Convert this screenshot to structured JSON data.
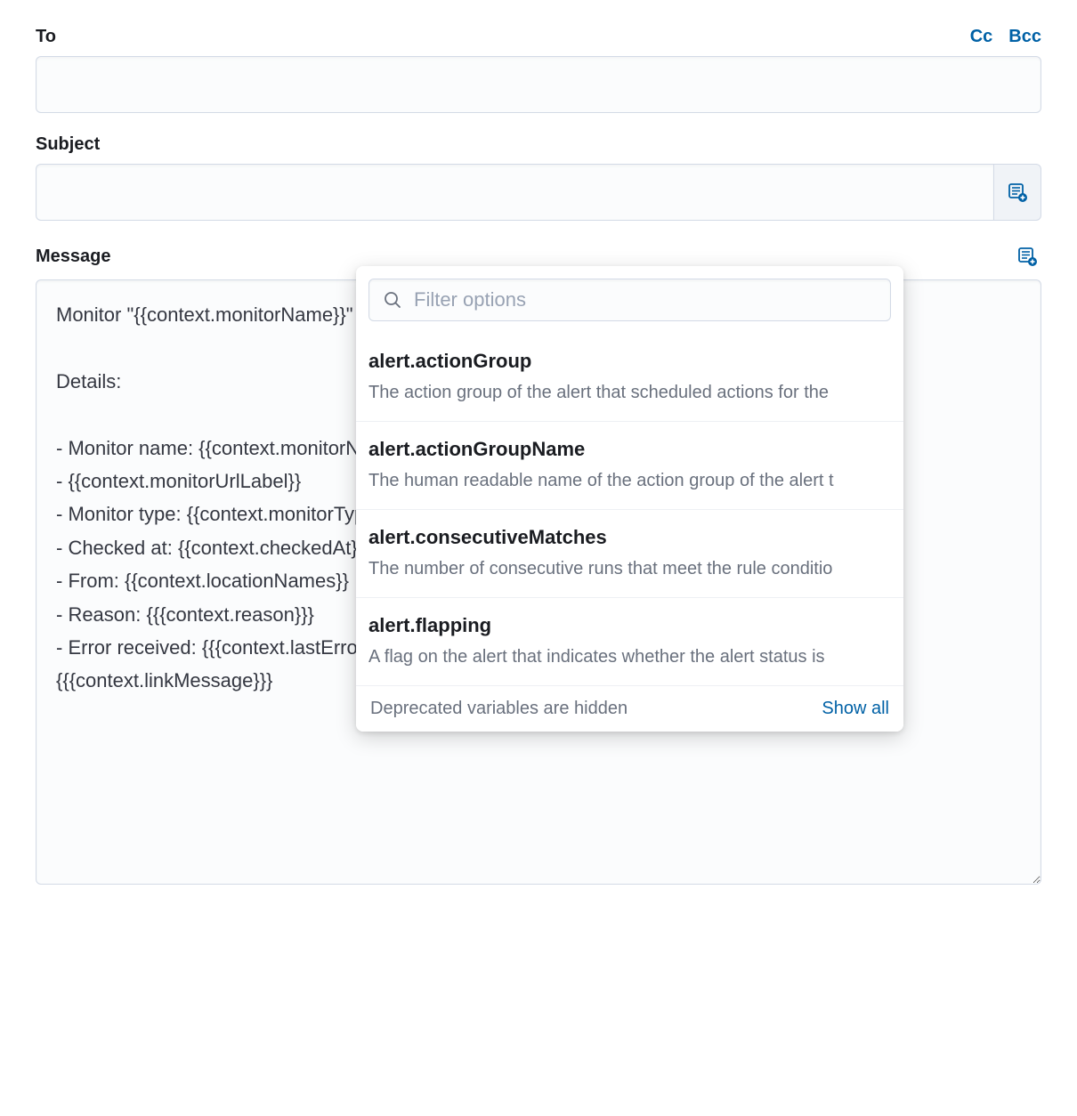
{
  "fields": {
    "to": {
      "label": "To",
      "value": "",
      "cc_label": "Cc",
      "bcc_label": "Bcc"
    },
    "subject": {
      "label": "Subject",
      "value": ""
    },
    "message": {
      "label": "Message",
      "value": "Monitor \"{{context.monitorName}}\" {{context.locationNames}}.{{\n\nDetails:\n\n- Monitor name: {{context.monitorName}}\n- {{context.monitorUrlLabel}}\n- Monitor type: {{context.monitorType}}\n- Checked at: {{context.checkedAt}}\n- From: {{context.locationNames}}\n- Reason: {{{context.reason}}}\n- Error received: {{{context.lastError}}}\n{{{context.linkMessage}}}"
    }
  },
  "popover": {
    "filter_placeholder": "Filter options",
    "options": [
      {
        "title": "alert.actionGroup",
        "desc": "The action group of the alert that scheduled actions for the"
      },
      {
        "title": "alert.actionGroupName",
        "desc": "The human readable name of the action group of the alert t"
      },
      {
        "title": "alert.consecutiveMatches",
        "desc": "The number of consecutive runs that meet the rule conditio"
      },
      {
        "title": "alert.flapping",
        "desc": "A flag on the alert that indicates whether the alert status is"
      }
    ],
    "footer": {
      "deprecated_text": "Deprecated variables are hidden",
      "show_all_label": "Show all"
    }
  }
}
